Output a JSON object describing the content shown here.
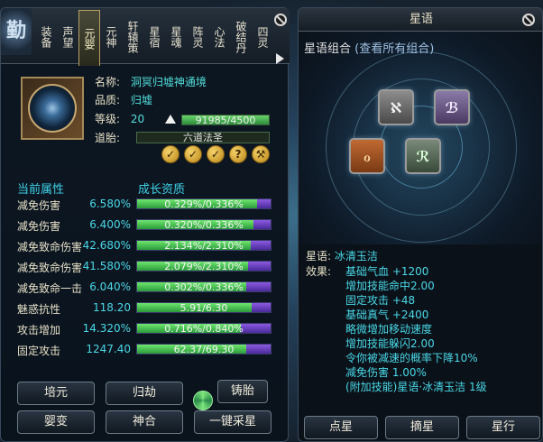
{
  "left": {
    "logo_char": "勤",
    "tabs": [
      "装备",
      "声望",
      "元婴",
      "元神",
      "轩辕策",
      "星宿",
      "星魂",
      "阵灵",
      "心法",
      "破结丹",
      "四灵"
    ],
    "active_tab_index": 2,
    "info": {
      "name_key": "名称:",
      "name_val": "洞冥归墟神通境",
      "quality_key": "品质:",
      "quality_val": "归墟",
      "level_key": "等级:",
      "level_val": "20",
      "exp_text": "91985/4500",
      "exp_ratio": 1.0,
      "dao_key": "道胎:",
      "dao_text": "六道法圣"
    },
    "badges": [
      "✓",
      "✓",
      "✓",
      "?",
      "⚒"
    ],
    "header_attr": "当前属性",
    "header_growth": "成长资质",
    "rows": [
      {
        "label": "减免伤害",
        "value": "6.580%",
        "bar": "0.329%/0.336%",
        "ratio": 0.9
      },
      {
        "label": "减免伤害",
        "value": "6.400%",
        "bar": "0.320%/0.336%",
        "ratio": 0.87
      },
      {
        "label": "减免致命伤害",
        "value": "42.680%",
        "bar": "2.134%/2.310%",
        "ratio": 0.85
      },
      {
        "label": "减免致命伤害",
        "value": "41.580%",
        "bar": "2.079%/2.310%",
        "ratio": 0.83
      },
      {
        "label": "减免致命一击",
        "value": "6.040%",
        "bar": "0.302%/0.336%",
        "ratio": 0.82
      },
      {
        "label": "魅惑抗性",
        "value": "118.20",
        "bar": "5.91/6.30",
        "ratio": 0.86
      },
      {
        "label": "攻击增加",
        "value": "14.320%",
        "bar": "0.716%/0.840%",
        "ratio": 0.78
      },
      {
        "label": "固定攻击",
        "value": "1247.40",
        "bar": "62.37/69.30",
        "ratio": 0.82
      }
    ],
    "buttons": {
      "peiyuan": "培元",
      "guijie": "归劫",
      "zhutai": "铸胎",
      "yingbian": "婴变",
      "shenhe": "神合",
      "caixing": "一键采星"
    }
  },
  "right": {
    "title": "星语",
    "combo_label": "星语组合",
    "combo_link": "(查看所有组合)",
    "gems": [
      {
        "symbol": "ℵ",
        "color": "#e6e6e6"
      },
      {
        "symbol": "ℬ",
        "color": "#ded2f0"
      },
      {
        "symbol": "ℴ",
        "color": "#d8743a"
      },
      {
        "symbol": "ℛ",
        "color": "#bfe6bf"
      }
    ],
    "star_key": "星语:",
    "star_val": "冰清玉洁",
    "effect_key": "效果:",
    "effects": [
      "基础气血 +1200",
      "增加技能命中2.00",
      "固定攻击 +48",
      "基础真气 +2400",
      "略微增加移动速度",
      "增加技能躲闪2.00",
      "令你被减速的概率下降10%",
      "减免伤害 1.00%",
      "(附加技能)星语·冰清玉洁 1级"
    ],
    "buttons": [
      "点星",
      "摘星",
      "星行"
    ]
  }
}
